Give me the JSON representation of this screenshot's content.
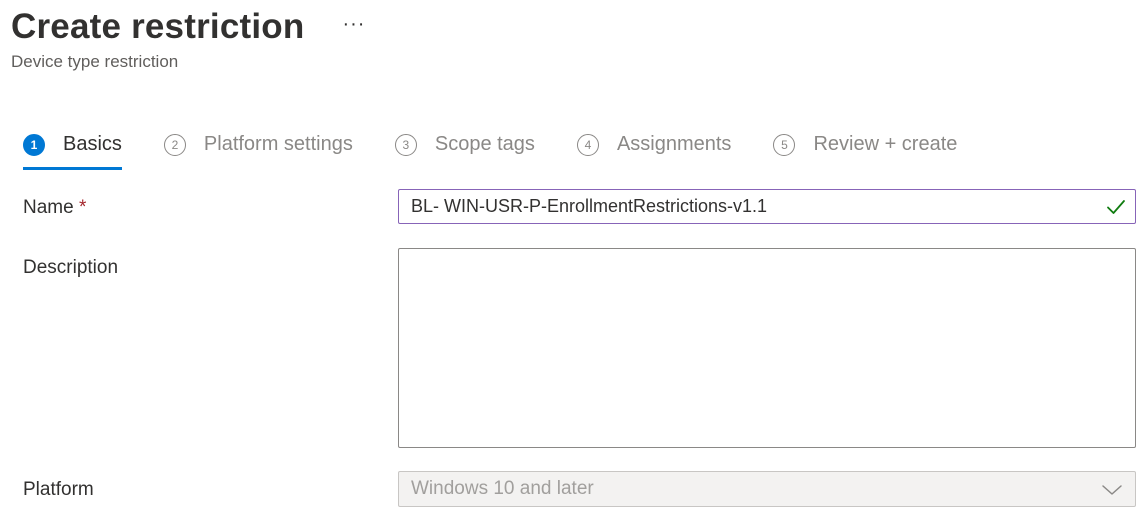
{
  "header": {
    "title": "Create restriction",
    "more_label": "···",
    "subtitle": "Device type restriction"
  },
  "wizard": {
    "steps": [
      {
        "number": "1",
        "label": "Basics",
        "active": true
      },
      {
        "number": "2",
        "label": "Platform settings",
        "active": false
      },
      {
        "number": "3",
        "label": "Scope tags",
        "active": false
      },
      {
        "number": "4",
        "label": "Assignments",
        "active": false
      },
      {
        "number": "5",
        "label": "Review + create",
        "active": false
      }
    ]
  },
  "form": {
    "name_label": "Name",
    "required_mark": "*",
    "name_value": "BL- WIN-USR-P-EnrollmentRestrictions-v1.1",
    "description_label": "Description",
    "description_value": "",
    "platform_label": "Platform",
    "platform_value": "Windows 10 and later"
  },
  "colors": {
    "accent": "#0078d4",
    "input_focus_border": "#8764b8",
    "valid_check": "#107c10",
    "required": "#a4262c"
  },
  "icons": {
    "valid": "checkmark-icon",
    "dropdown": "chevron-down-icon",
    "more": "more-ellipsis-icon"
  }
}
